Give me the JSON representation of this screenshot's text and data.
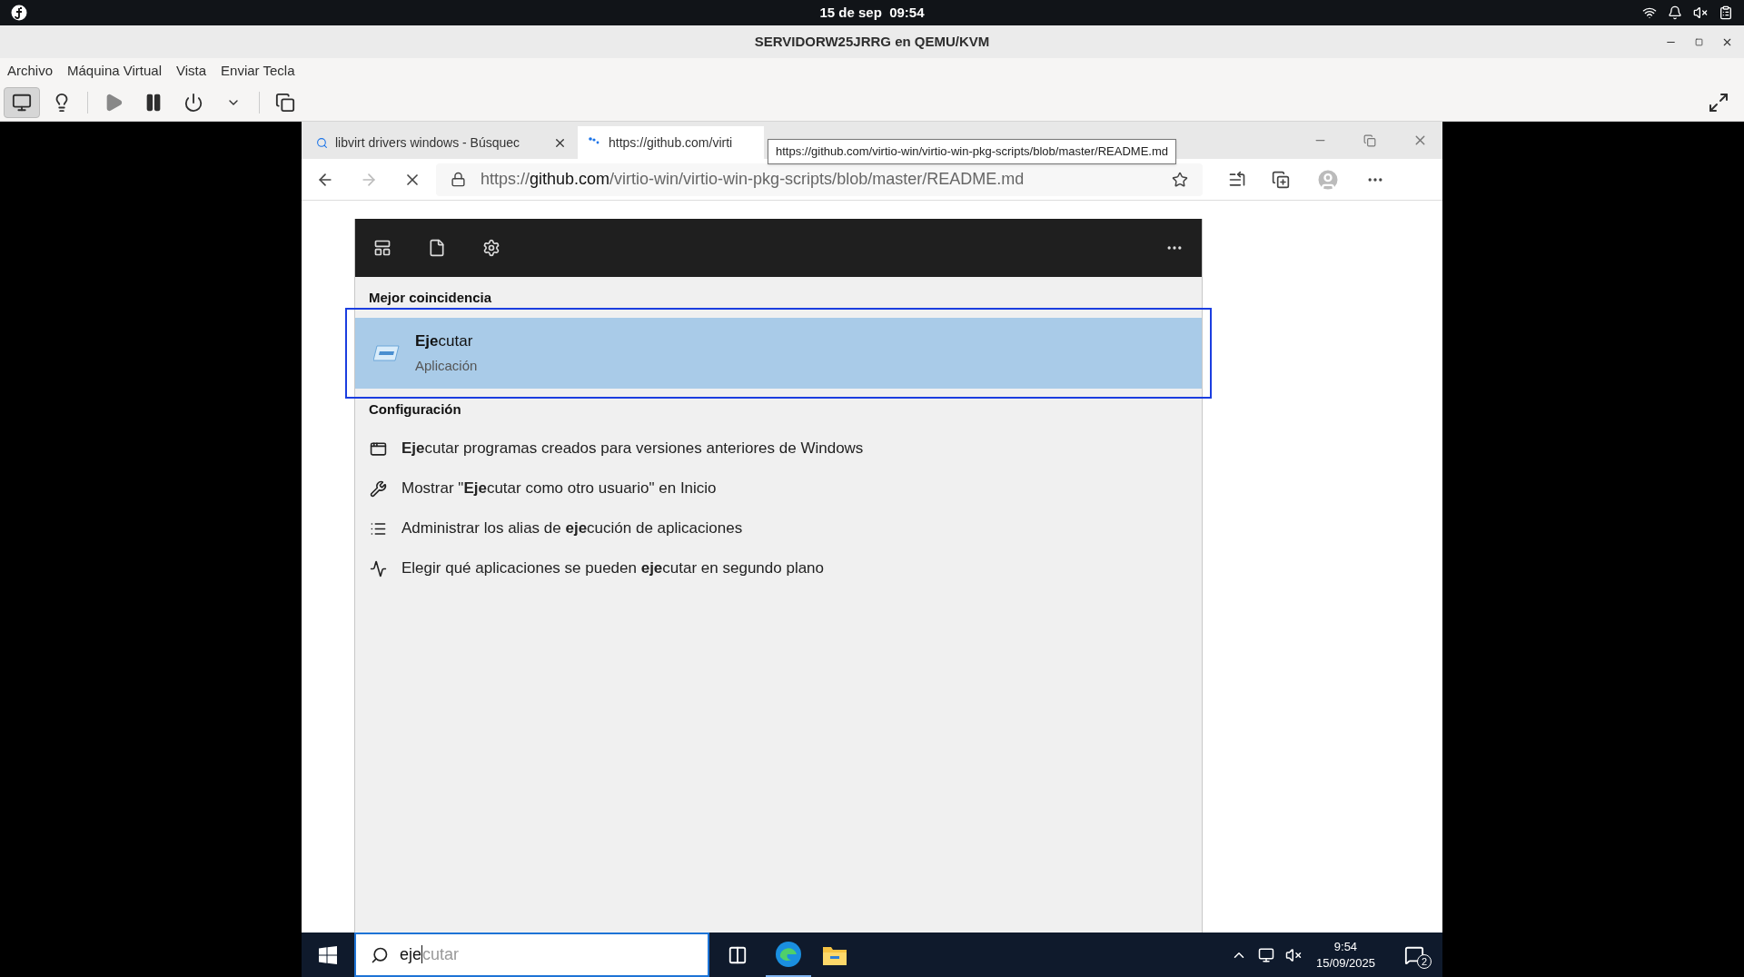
{
  "top_bar": {
    "clock": "15 de sep  09:54"
  },
  "window": {
    "title": "SERVIDORW25JRRG en QEMU/KVM"
  },
  "menu": [
    "Archivo",
    "Máquina Virtual",
    "Vista",
    "Enviar Tecla"
  ],
  "toolbar": [
    {
      "kind": "console",
      "selected": true
    },
    {
      "kind": "details",
      "selected": false
    },
    {
      "kind": "run",
      "selected": false
    },
    {
      "kind": "pause",
      "selected": false
    },
    {
      "kind": "power",
      "selected": false
    },
    {
      "kind": "dropdown",
      "selected": false
    },
    {
      "kind": "snapshots",
      "selected": false
    }
  ],
  "browser": {
    "tabs": [
      {
        "kind": "search",
        "label": "libvirt drivers windows - Búsquec",
        "selected": false
      },
      {
        "kind": "loading",
        "label": "https://github.com/virti",
        "selected": true
      }
    ],
    "address": {
      "scheme": "https://",
      "domain": "github.com",
      "path": "/virtio-win/virtio-win-pkg-scripts/blob/master/README.md"
    },
    "tooltip": "https://github.com/virtio-win/virtio-win-pkg-scripts/blob/master/README.md"
  },
  "search_panel": {
    "best_match_heading": "Mejor coincidencia",
    "best_match": {
      "title": "**Eje**cutar",
      "subtitle": "Aplicación",
      "selected": true
    },
    "settings_heading": "Configuración",
    "settings": [
      {
        "kind": "compat",
        "text": "**Eje**cutar programas creados para versiones anteriores de Windows"
      },
      {
        "kind": "tools",
        "text": "Mostrar \"**Eje**cutar como otro usuario\" en Inicio"
      },
      {
        "kind": "list",
        "text": "Administrar los alias de **eje**cución de aplicaciones"
      },
      {
        "kind": "activity",
        "text": "Elegir qué aplicaciones se pueden **eje**cutar en segundo plano"
      }
    ]
  },
  "taskbar": {
    "search": {
      "value": "eje",
      "suggestion": "cutar"
    },
    "clock": {
      "time": "9:54",
      "date": "15/09/2025"
    },
    "notifications": "2"
  }
}
